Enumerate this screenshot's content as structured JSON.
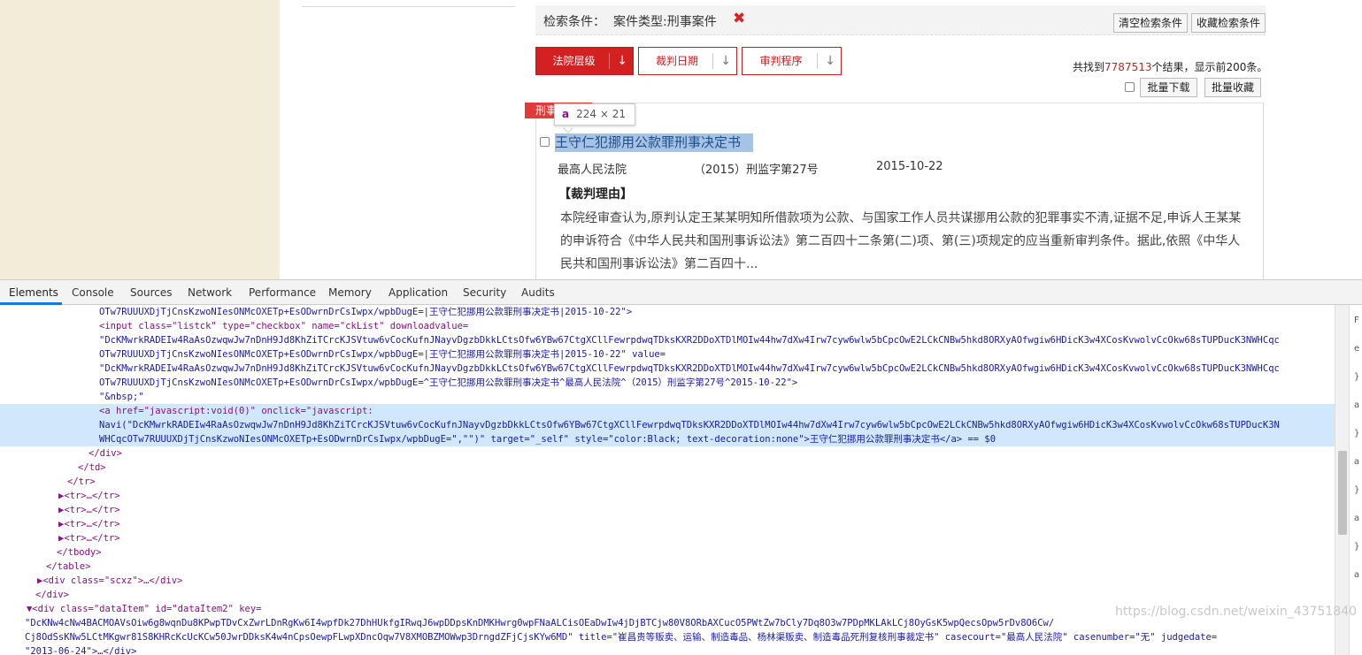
{
  "search": {
    "criteria_label": "检索条件：",
    "criteria_value": "案件类型:刑事案件",
    "clear_label": "清空检索条件",
    "save_label": "收藏检索条件"
  },
  "sort_buttons": [
    {
      "label": "法院层级"
    },
    {
      "label": "裁判日期"
    },
    {
      "label": "审判程序"
    }
  ],
  "results": {
    "prefix": "共找到",
    "count": "7787513",
    "suffix": "个结果，显示前200条。",
    "batch_download": "批量下载",
    "batch_favorite": "批量收藏"
  },
  "item": {
    "tag": "刑事",
    "title": "王守仁犯挪用公款罪刑事决定书",
    "court": "最高人民法院",
    "case_number": "（2015）刑监字第27号",
    "date": "2015-10-22",
    "reason_heading": "【裁判理由】",
    "reason_text": "本院经审查认为,原判认定王某某明知所借款项为公款、与国家工作人员共谋挪用公款的犯罪事实不清,证据不足,申诉人王某某的申诉符合《中华人民共和国刑事诉讼法》第二百四十二条第(二)项、第(三)项规定的应当重新审判条件。据此,依照《中华人民共和国刑事诉讼法》第二百四十..."
  },
  "inspect_tooltip": {
    "tag": "a",
    "dims": "224 × 21"
  },
  "devtools": {
    "tabs": [
      "Elements",
      "Console",
      "Sources",
      "Network",
      "Performance",
      "Memory",
      "Application",
      "Security",
      "Audits"
    ],
    "lines": [
      {
        "indent": 112,
        "text": "OTw7RUUUXDjTjCnsKzwoNIesONMcOXETp+EsODwrnDrCsIwpx/wpbDugE=|王守仁犯挪用公款罪刑事决定书|2015-10-22\">"
      },
      {
        "indent": 112,
        "text": "<input class=\"listck\" type=\"checkbox\" name=\"ckList\" downloadvalue="
      },
      {
        "indent": 112,
        "text": "\"DcKMwrkRADEIw4RaAsOzwqwJw7nDnH9Jd8KhZiTCrcKJSVtuw6vCocKufnJNayvDgzbDkkLCtsOfw6YBw67CtgXCllFewrpdwqTDksKXR2DDoXTDlMOIw44hw7dXw4Irw7cyw6wlw5bCpcOwE2LCkCNBw5hkd8ORXyAOfwgiw6HDicK3w4XCosKvwolvCcOkw68sTUPDucK3NWHCqc"
      },
      {
        "indent": 112,
        "text": "OTw7RUUUXDjTjCnsKzwoNIesONMcOXETp+EsODwrnDrCsIwpx/wpbDugE=|王守仁犯挪用公款罪刑事决定书|2015-10-22\" value="
      },
      {
        "indent": 112,
        "text": "\"DcKMwrkRADEIw4RaAsOzwqwJw7nDnH9Jd8KhZiTCrcKJSVtuw6vCocKufnJNayvDgzbDkkLCtsOfw6YBw67CtgXCllFewrpdwqTDksKXR2DDoXTDlMOIw44hw7dXw4Irw7cyw6wlw5bCpcOwE2LCkCNBw5hkd8ORXyAOfwgiw6HDicK3w4XCosKvwolvCcOkw68sTUPDucK3NWHCqc"
      },
      {
        "indent": 112,
        "text": "OTw7RUUUXDjTjCnsKzwoNIesONMcOXETp+EsODwrnDrCsIwpx/wpbDugE=^王守仁犯挪用公款罪刑事决定书^最高人民法院^（2015）刑监字第27号^2015-10-22\">"
      },
      {
        "indent": 112,
        "text": "\"&nbsp;\""
      },
      {
        "indent": 112,
        "text": "<a href=\"javascript:void(0)\" onclick=\"javascript:"
      },
      {
        "indent": 112,
        "text": "Navi(\"DcKMwrkRADEIw4RaAsOzwqwJw7nDnH9Jd8KhZiTCrcKJSVtuw6vCocKufnJNayvDgzbDkkLCtsOfw6YBw67CtgXCllFewrpdwqTDksKXR2DDoXTDlMOIw44hw7dXw4Irw7cyw6wlw5bCpcOwE2LCkCNBw5hkd8ORXyAOfwgiw6HDicK3w4XCosKvwolvCcOkw68sTUPDucK3N"
      },
      {
        "indent": 112,
        "text": "WHCqcOTw7RUUUXDjTjCnsKzwoNIesONMcOXETp+EsODwrnDrCsIwpx/wpbDugE=\",\"\")\" target=\"_self\" style=\"color:Black; text-decoration:none\">王守仁犯挪用公款罪刑事决定书</a> == $0"
      },
      {
        "indent": 100,
        "text": "</div>"
      },
      {
        "indent": 88,
        "text": "</td>"
      },
      {
        "indent": 76,
        "text": "</tr>"
      },
      {
        "indent": 66,
        "text": "▶<tr>…</tr>"
      },
      {
        "indent": 66,
        "text": "▶<tr>…</tr>"
      },
      {
        "indent": 66,
        "text": "▶<tr>…</tr>"
      },
      {
        "indent": 66,
        "text": "▶<tr>…</tr>"
      },
      {
        "indent": 64,
        "text": "</tbody>"
      },
      {
        "indent": 52,
        "text": "</table>"
      },
      {
        "indent": 42,
        "text": "▶<div class=\"scxz\">…</div>"
      },
      {
        "indent": 40,
        "text": "</div>"
      },
      {
        "indent": 30,
        "text": "▼<div class=\"dataItem\" id=\"dataItem2\" key="
      },
      {
        "indent": 28,
        "text": "\"DcKNw4cNw4BACMOAVsOiw6g8wqnDu8KPwpTDvCxZwrLDnRgKw6I4wpfDk27DhHUkfgIRwqJ6wpDDpsKnDMKHwrg0wpFNaALCisOEaDwIw4jDjBTCjw80V8ORbAXCucO5PWtZw7bCly7Dq8O3w7PDpMKLAkLCj8OyGsK5wpQecsOpw5rDv8O6Cw/"
      },
      {
        "indent": 28,
        "text": "Cj8OdSsKNw5LCtMKgwr81S8KHRcKcUcKCw50JwrDDksK4w4nCpsOewpFLwpXDncOqw7V8XMOBZMOWwp3DrngdZFjCjsKYw6MD\" title=\"崔昌贵等贩卖、运输、制造毒品、杨林渠贩卖、制造毒品死刑复核刑事裁定书\" casecourt=\"最高人民法院\" casenumber=\"无\" judgedate="
      },
      {
        "indent": 28,
        "text": "\"2013-06-24\">…</div>"
      },
      {
        "indent": 30,
        "text": "▶<div class=\"dataItem\" id=\"dataItem3\" key="
      }
    ],
    "side_chars": [
      "F",
      "e",
      "}",
      "a",
      "}",
      "a",
      "}",
      "a",
      "}",
      "a"
    ]
  },
  "watermark": "https://blog.csdn.net/weixin_43751840"
}
